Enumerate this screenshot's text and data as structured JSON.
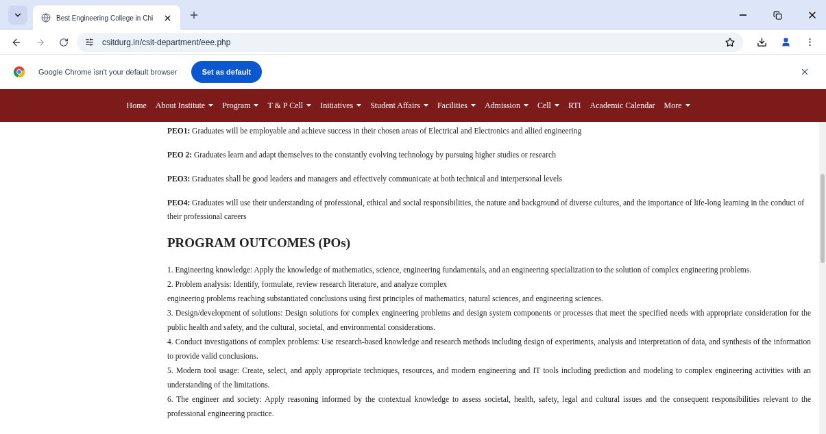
{
  "browser": {
    "tab_title": "Best Engineering College in Chi",
    "url": "csitdurg.in/csit-department/eee.php",
    "infobar_text": "Google Chrome isn't your default browser",
    "infobar_button": "Set as default"
  },
  "nav": [
    {
      "label": "Home",
      "dropdown": false
    },
    {
      "label": "About Institute",
      "dropdown": true
    },
    {
      "label": "Program",
      "dropdown": true
    },
    {
      "label": "T & P Cell",
      "dropdown": true
    },
    {
      "label": "Initiatives",
      "dropdown": true
    },
    {
      "label": "Student Affairs",
      "dropdown": true
    },
    {
      "label": "Facilities",
      "dropdown": true
    },
    {
      "label": "Admission",
      "dropdown": true
    },
    {
      "label": "Cell",
      "dropdown": true
    },
    {
      "label": "RTI",
      "dropdown": false
    },
    {
      "label": "Academic Calendar",
      "dropdown": false
    },
    {
      "label": "More",
      "dropdown": true
    }
  ],
  "peos": [
    "**PEO1:** Graduates will be employable and achieve success in their chosen areas of Electrical and Electronics and allied engineering",
    "**PEO 2:** Graduates learn and adapt themselves to the constantly evolving technology by pursuing higher studies or research",
    "**PEO3:** Graduates shall be good leaders and managers and effectively communicate at both technical and interpersonal levels",
    "**PEO4:** Graduates will use their understanding of professional, ethical and social responsibilities, the nature and background of diverse cultures, and the importance of life-long learning in the conduct of their professional careers"
  ],
  "po_heading": "PROGRAM OUTCOMES (POs)",
  "pos": [
    "1. Engineering knowledge: Apply the knowledge of mathematics, science, engineering fundamentals, and an engineering specialization to the solution of complex engineering problems.",
    "2. Problem analysis: Identify, formulate, review research literature, and analyze complex",
    "engineering problems reaching substantiated conclusions using first principles of mathematics, natural sciences, and engineering sciences.",
    "3. Design/development of solutions: Design solutions for complex engineering problems and design system components or processes that meet the specified needs with appropriate consideration for the public health and safety, and the cultural, societal, and environmental considerations.",
    "4. Conduct investigations of complex problems: Use research-based knowledge and research methods including design of experiments, analysis and interpretation of data, and synthesis of the information to provide valid conclusions.",
    "5. Modern tool usage: Create, select, and apply appropriate techniques, resources, and modern engineering and IT tools including prediction and modeling to complex engineering activities with an understanding of the limitations.",
    "6. The engineer and society: Apply reasoning informed by the contextual knowledge to assess societal, health, safety, legal and cultural issues and the consequent responsibilities relevant to the professional engineering practice."
  ]
}
